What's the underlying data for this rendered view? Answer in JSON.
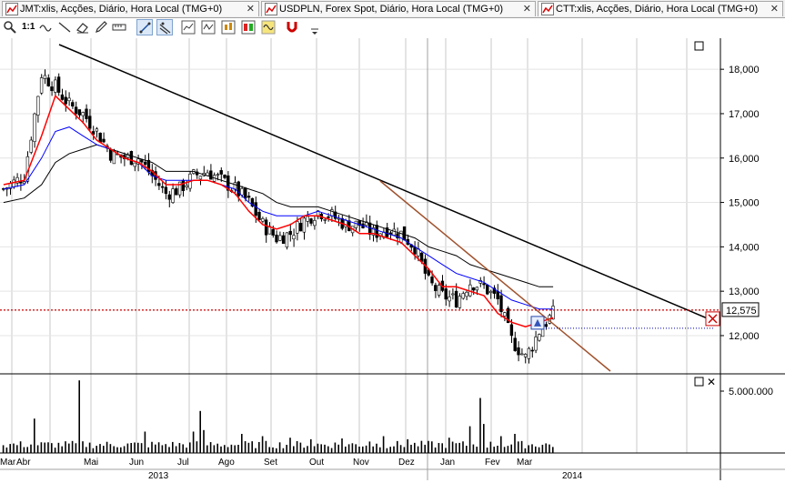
{
  "tabs": [
    {
      "label": "JMT:xlis, Acções, Diário, Hora Local (TMG+0)"
    },
    {
      "label": "USDPLN, Forex Spot, Diário, Hora Local (TMG+0)"
    },
    {
      "label": "CTT:xlis, Acções, Diário, Hora Local (TMG+0)"
    }
  ],
  "toolbar": {
    "zoom_label": "1:1",
    "tools": [
      "zoom-icon",
      "one-to-one-icon",
      "hand-wave-icon",
      "line-tool-icon",
      "eraser-icon",
      "pencil-icon",
      "trendline-icon",
      "multi-line-icon",
      "chart-type-a-icon",
      "chart-type-b-icon",
      "chart-type-c-icon",
      "chart-type-d-icon",
      "chart-type-e-icon",
      "magnet-icon"
    ]
  },
  "colors": {
    "up": "#000000",
    "down": "#000000",
    "ma_fast": "#ff0000",
    "ma_mid": "#0000ff",
    "ma_slow": "#000000",
    "trendline_long": "#000000",
    "trendline_short": "#a0522d",
    "price_marker": "#cc0000"
  },
  "chart_data": {
    "type": "candlestick",
    "current_price_label": "12,575",
    "current_price": 12.575,
    "y_ticks": [
      "18,000",
      "17,000",
      "16,000",
      "15,000",
      "14,000",
      "13,000",
      "12,000"
    ],
    "y_tick_values": [
      18,
      17,
      16,
      15,
      14,
      13,
      12
    ],
    "ylim": [
      11.2,
      18.7
    ],
    "volume_tick_label": "5.000.000",
    "volume_tick_value": 5000000,
    "x_month_labels": [
      "Mar",
      "Abr",
      "Mai",
      "Jun",
      "Jul",
      "Ago",
      "Set",
      "Out",
      "Nov",
      "Dez",
      "Jan",
      "Fev",
      "Mar"
    ],
    "x_year_labels": [
      "2013",
      "2014"
    ],
    "price_path": [
      [
        0,
        15.3
      ],
      [
        6,
        15.6
      ],
      [
        11,
        17.9
      ],
      [
        15,
        17.6
      ],
      [
        19,
        17.2
      ],
      [
        23,
        17.0
      ],
      [
        27,
        16.6
      ],
      [
        31,
        16.1
      ],
      [
        35,
        16.0
      ],
      [
        39,
        16.0
      ],
      [
        43,
        15.6
      ],
      [
        47,
        15.2
      ],
      [
        51,
        15.3
      ],
      [
        55,
        15.6
      ],
      [
        59,
        15.7
      ],
      [
        63,
        15.5
      ],
      [
        67,
        15.3
      ],
      [
        71,
        15.0
      ],
      [
        75,
        14.5
      ],
      [
        79,
        14.2
      ],
      [
        83,
        14.3
      ],
      [
        87,
        14.6
      ],
      [
        91,
        14.8
      ],
      [
        95,
        14.7
      ],
      [
        99,
        14.5
      ],
      [
        103,
        14.5
      ],
      [
        107,
        14.3
      ],
      [
        111,
        14.4
      ],
      [
        115,
        14.3
      ],
      [
        119,
        14.0
      ],
      [
        123,
        13.2
      ],
      [
        127,
        12.9
      ],
      [
        131,
        12.8
      ],
      [
        135,
        13.2
      ],
      [
        139,
        13.1
      ],
      [
        143,
        12.8
      ],
      [
        147,
        11.9
      ],
      [
        151,
        11.5
      ],
      [
        155,
        12.1
      ],
      [
        159,
        12.5
      ]
    ],
    "ma_fast_path": [
      [
        0,
        15.4
      ],
      [
        6,
        15.5
      ],
      [
        11,
        16.5
      ],
      [
        15,
        17.4
      ],
      [
        19,
        17.1
      ],
      [
        23,
        16.8
      ],
      [
        27,
        16.4
      ],
      [
        31,
        16.2
      ],
      [
        35,
        16.0
      ],
      [
        39,
        15.9
      ],
      [
        43,
        15.7
      ],
      [
        47,
        15.4
      ],
      [
        51,
        15.4
      ],
      [
        55,
        15.5
      ],
      [
        59,
        15.5
      ],
      [
        63,
        15.4
      ],
      [
        67,
        15.2
      ],
      [
        71,
        14.8
      ],
      [
        75,
        14.5
      ],
      [
        79,
        14.4
      ],
      [
        83,
        14.5
      ],
      [
        87,
        14.7
      ],
      [
        91,
        14.7
      ],
      [
        95,
        14.6
      ],
      [
        99,
        14.5
      ],
      [
        103,
        14.3
      ],
      [
        107,
        14.3
      ],
      [
        111,
        14.2
      ],
      [
        115,
        14.1
      ],
      [
        119,
        13.8
      ],
      [
        123,
        13.5
      ],
      [
        127,
        13.1
      ],
      [
        131,
        13.1
      ],
      [
        135,
        13.0
      ],
      [
        139,
        12.9
      ],
      [
        143,
        12.5
      ],
      [
        147,
        12.3
      ],
      [
        151,
        12.2
      ],
      [
        155,
        12.3
      ],
      [
        159,
        12.4
      ]
    ],
    "ma_mid_path": [
      [
        0,
        15.3
      ],
      [
        6,
        15.4
      ],
      [
        11,
        16.0
      ],
      [
        15,
        16.6
      ],
      [
        19,
        16.7
      ],
      [
        23,
        16.5
      ],
      [
        27,
        16.3
      ],
      [
        31,
        16.2
      ],
      [
        35,
        16.0
      ],
      [
        39,
        15.9
      ],
      [
        43,
        15.6
      ],
      [
        47,
        15.5
      ],
      [
        51,
        15.5
      ],
      [
        55,
        15.5
      ],
      [
        59,
        15.5
      ],
      [
        63,
        15.4
      ],
      [
        67,
        15.3
      ],
      [
        71,
        15.0
      ],
      [
        75,
        14.8
      ],
      [
        79,
        14.7
      ],
      [
        83,
        14.7
      ],
      [
        87,
        14.7
      ],
      [
        91,
        14.8
      ],
      [
        95,
        14.7
      ],
      [
        99,
        14.6
      ],
      [
        103,
        14.5
      ],
      [
        107,
        14.4
      ],
      [
        111,
        14.3
      ],
      [
        115,
        14.2
      ],
      [
        119,
        14.0
      ],
      [
        123,
        13.8
      ],
      [
        127,
        13.6
      ],
      [
        131,
        13.4
      ],
      [
        135,
        13.3
      ],
      [
        139,
        13.2
      ],
      [
        143,
        13.0
      ],
      [
        147,
        12.8
      ],
      [
        151,
        12.7
      ],
      [
        155,
        12.6
      ],
      [
        159,
        12.6
      ]
    ],
    "ma_slow_path": [
      [
        0,
        15.0
      ],
      [
        6,
        15.1
      ],
      [
        11,
        15.4
      ],
      [
        15,
        15.9
      ],
      [
        19,
        16.1
      ],
      [
        23,
        16.2
      ],
      [
        27,
        16.3
      ],
      [
        31,
        16.2
      ],
      [
        35,
        16.1
      ],
      [
        39,
        16.0
      ],
      [
        43,
        15.9
      ],
      [
        47,
        15.7
      ],
      [
        51,
        15.7
      ],
      [
        55,
        15.7
      ],
      [
        59,
        15.6
      ],
      [
        63,
        15.5
      ],
      [
        67,
        15.4
      ],
      [
        71,
        15.3
      ],
      [
        75,
        15.2
      ],
      [
        79,
        15.0
      ],
      [
        83,
        14.9
      ],
      [
        87,
        14.9
      ],
      [
        91,
        14.9
      ],
      [
        95,
        14.8
      ],
      [
        99,
        14.7
      ],
      [
        103,
        14.6
      ],
      [
        107,
        14.5
      ],
      [
        111,
        14.4
      ],
      [
        115,
        14.3
      ],
      [
        119,
        14.2
      ],
      [
        123,
        14.0
      ],
      [
        127,
        13.9
      ],
      [
        131,
        13.8
      ],
      [
        135,
        13.6
      ],
      [
        139,
        13.5
      ],
      [
        143,
        13.4
      ],
      [
        147,
        13.3
      ],
      [
        151,
        13.2
      ],
      [
        155,
        13.1
      ],
      [
        159,
        13.1
      ]
    ],
    "trendline_long": [
      [
        0,
        18.5
      ],
      [
        4,
        18.2
      ],
      [
        120,
        13.9
      ]
    ],
    "trendline_short": [
      [
        85,
        15.4
      ],
      [
        150,
        11.2
      ]
    ],
    "volume_spikes": [
      [
        9,
        0.45
      ],
      [
        22,
        0.95
      ],
      [
        41,
        0.28
      ],
      [
        55,
        0.28
      ],
      [
        57,
        0.55
      ],
      [
        58,
        0.3
      ],
      [
        69,
        0.25
      ],
      [
        75,
        0.22
      ],
      [
        83,
        0.2
      ],
      [
        89,
        0.18
      ],
      [
        98,
        0.19
      ],
      [
        106,
        0.15
      ],
      [
        110,
        0.22
      ],
      [
        117,
        0.18
      ],
      [
        129,
        0.2
      ],
      [
        135,
        0.35
      ],
      [
        138,
        0.72
      ],
      [
        139,
        0.38
      ],
      [
        144,
        0.22
      ],
      [
        148,
        0.25
      ]
    ]
  }
}
